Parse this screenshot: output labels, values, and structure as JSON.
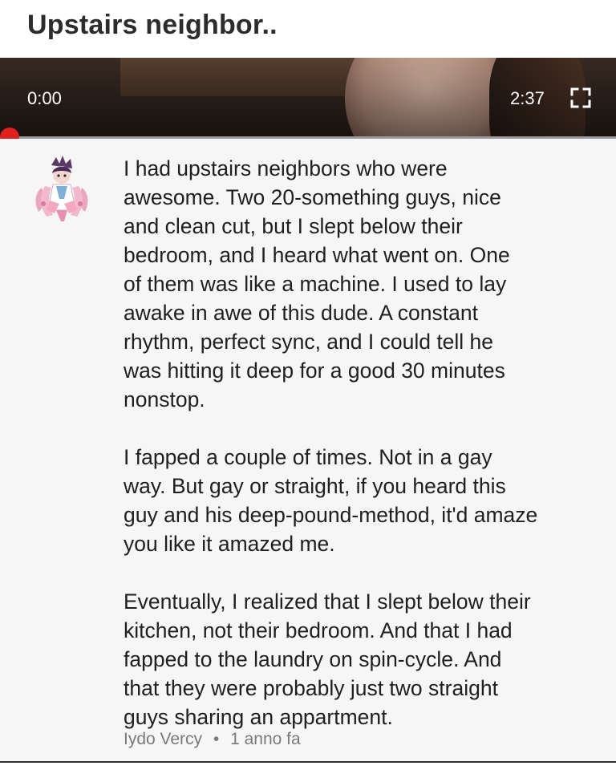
{
  "post": {
    "title": "Upstairs neighbor.."
  },
  "video": {
    "current_time": "0:00",
    "duration": "2:37",
    "progress": 0,
    "fullscreen_icon": "fullscreen-icon"
  },
  "comment": {
    "paragraphs": [
      "I had upstairs neighbors who were\nawesome. Two 20-something guys, nice\nand clean cut, but I slept below their\nbedroom, and I heard what went on. One\nof them was like a machine. I used to lay\nawake in awe of this dude. A constant\nrhythm, perfect sync, and I could tell he\nwas hitting it deep for a good 30 minutes\nnonstop.",
      "I fapped a couple of times. Not in a gay\nway. But gay or straight, if you heard this\nguy and his deep-pound-method, it'd amaze\nyou like it amazed me.",
      "Eventually, I realized that I slept below their\nkitchen, not their bedroom. And that I had\nfapped to the laundry on spin-cycle. And\nthat they were probably just two straight\nguys sharing an appartment."
    ],
    "author": "Iydo Vercy",
    "separator": "•",
    "time_ago": "1 anno fa"
  },
  "colors": {
    "progress_handle": "#e0201d",
    "comment_background": "#f6f6f6",
    "meta_text": "#7a7a7a"
  }
}
